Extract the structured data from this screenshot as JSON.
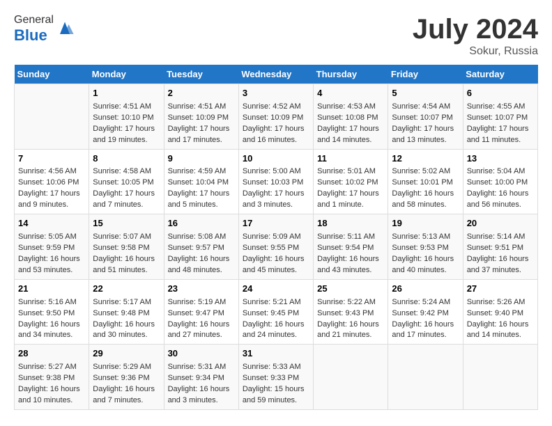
{
  "header": {
    "logo_general": "General",
    "logo_blue": "Blue",
    "month_year": "July 2024",
    "location": "Sokur, Russia"
  },
  "days_of_week": [
    "Sunday",
    "Monday",
    "Tuesday",
    "Wednesday",
    "Thursday",
    "Friday",
    "Saturday"
  ],
  "weeks": [
    [
      {
        "day": "",
        "info": ""
      },
      {
        "day": "1",
        "info": "Sunrise: 4:51 AM\nSunset: 10:10 PM\nDaylight: 17 hours\nand 19 minutes."
      },
      {
        "day": "2",
        "info": "Sunrise: 4:51 AM\nSunset: 10:09 PM\nDaylight: 17 hours\nand 17 minutes."
      },
      {
        "day": "3",
        "info": "Sunrise: 4:52 AM\nSunset: 10:09 PM\nDaylight: 17 hours\nand 16 minutes."
      },
      {
        "day": "4",
        "info": "Sunrise: 4:53 AM\nSunset: 10:08 PM\nDaylight: 17 hours\nand 14 minutes."
      },
      {
        "day": "5",
        "info": "Sunrise: 4:54 AM\nSunset: 10:07 PM\nDaylight: 17 hours\nand 13 minutes."
      },
      {
        "day": "6",
        "info": "Sunrise: 4:55 AM\nSunset: 10:07 PM\nDaylight: 17 hours\nand 11 minutes."
      }
    ],
    [
      {
        "day": "7",
        "info": "Sunrise: 4:56 AM\nSunset: 10:06 PM\nDaylight: 17 hours\nand 9 minutes."
      },
      {
        "day": "8",
        "info": "Sunrise: 4:58 AM\nSunset: 10:05 PM\nDaylight: 17 hours\nand 7 minutes."
      },
      {
        "day": "9",
        "info": "Sunrise: 4:59 AM\nSunset: 10:04 PM\nDaylight: 17 hours\nand 5 minutes."
      },
      {
        "day": "10",
        "info": "Sunrise: 5:00 AM\nSunset: 10:03 PM\nDaylight: 17 hours\nand 3 minutes."
      },
      {
        "day": "11",
        "info": "Sunrise: 5:01 AM\nSunset: 10:02 PM\nDaylight: 17 hours\nand 1 minute."
      },
      {
        "day": "12",
        "info": "Sunrise: 5:02 AM\nSunset: 10:01 PM\nDaylight: 16 hours\nand 58 minutes."
      },
      {
        "day": "13",
        "info": "Sunrise: 5:04 AM\nSunset: 10:00 PM\nDaylight: 16 hours\nand 56 minutes."
      }
    ],
    [
      {
        "day": "14",
        "info": "Sunrise: 5:05 AM\nSunset: 9:59 PM\nDaylight: 16 hours\nand 53 minutes."
      },
      {
        "day": "15",
        "info": "Sunrise: 5:07 AM\nSunset: 9:58 PM\nDaylight: 16 hours\nand 51 minutes."
      },
      {
        "day": "16",
        "info": "Sunrise: 5:08 AM\nSunset: 9:57 PM\nDaylight: 16 hours\nand 48 minutes."
      },
      {
        "day": "17",
        "info": "Sunrise: 5:09 AM\nSunset: 9:55 PM\nDaylight: 16 hours\nand 45 minutes."
      },
      {
        "day": "18",
        "info": "Sunrise: 5:11 AM\nSunset: 9:54 PM\nDaylight: 16 hours\nand 43 minutes."
      },
      {
        "day": "19",
        "info": "Sunrise: 5:13 AM\nSunset: 9:53 PM\nDaylight: 16 hours\nand 40 minutes."
      },
      {
        "day": "20",
        "info": "Sunrise: 5:14 AM\nSunset: 9:51 PM\nDaylight: 16 hours\nand 37 minutes."
      }
    ],
    [
      {
        "day": "21",
        "info": "Sunrise: 5:16 AM\nSunset: 9:50 PM\nDaylight: 16 hours\nand 34 minutes."
      },
      {
        "day": "22",
        "info": "Sunrise: 5:17 AM\nSunset: 9:48 PM\nDaylight: 16 hours\nand 30 minutes."
      },
      {
        "day": "23",
        "info": "Sunrise: 5:19 AM\nSunset: 9:47 PM\nDaylight: 16 hours\nand 27 minutes."
      },
      {
        "day": "24",
        "info": "Sunrise: 5:21 AM\nSunset: 9:45 PM\nDaylight: 16 hours\nand 24 minutes."
      },
      {
        "day": "25",
        "info": "Sunrise: 5:22 AM\nSunset: 9:43 PM\nDaylight: 16 hours\nand 21 minutes."
      },
      {
        "day": "26",
        "info": "Sunrise: 5:24 AM\nSunset: 9:42 PM\nDaylight: 16 hours\nand 17 minutes."
      },
      {
        "day": "27",
        "info": "Sunrise: 5:26 AM\nSunset: 9:40 PM\nDaylight: 16 hours\nand 14 minutes."
      }
    ],
    [
      {
        "day": "28",
        "info": "Sunrise: 5:27 AM\nSunset: 9:38 PM\nDaylight: 16 hours\nand 10 minutes."
      },
      {
        "day": "29",
        "info": "Sunrise: 5:29 AM\nSunset: 9:36 PM\nDaylight: 16 hours\nand 7 minutes."
      },
      {
        "day": "30",
        "info": "Sunrise: 5:31 AM\nSunset: 9:34 PM\nDaylight: 16 hours\nand 3 minutes."
      },
      {
        "day": "31",
        "info": "Sunrise: 5:33 AM\nSunset: 9:33 PM\nDaylight: 15 hours\nand 59 minutes."
      },
      {
        "day": "",
        "info": ""
      },
      {
        "day": "",
        "info": ""
      },
      {
        "day": "",
        "info": ""
      }
    ]
  ]
}
